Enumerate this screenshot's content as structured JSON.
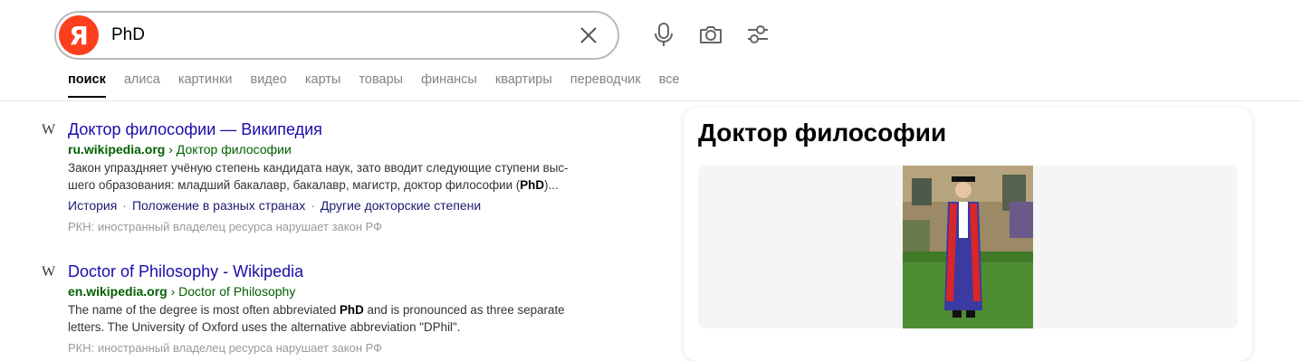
{
  "search": {
    "logo_letter": "Я",
    "query": "PhD"
  },
  "tabs": [
    "поиск",
    "алиса",
    "картинки",
    "видео",
    "карты",
    "товары",
    "финансы",
    "квартиры",
    "переводчик",
    "все"
  ],
  "results": [
    {
      "favicon": "W",
      "title": "Доктор философии — Википедия",
      "domain": "ru.wikipedia.org",
      "path": "› Доктор философии",
      "snippet_line1": "Закон упраздняет учёную степень кандидата наук, зато вводит следующие ступени выс-",
      "snippet_line2_pre": "шего образования: младший бакалавр, бакалавр, магистр, доктор философии (",
      "snippet_bold": "PhD",
      "snippet_line2_post": ")...",
      "links": [
        "История",
        "Положение в разных странах",
        "Другие докторские степени"
      ],
      "warning": "РКН: иностранный владелец ресурса нарушает закон РФ"
    },
    {
      "favicon": "W",
      "title": "Doctor of Philosophy - Wikipedia",
      "domain": "en.wikipedia.org",
      "path": "› Doctor of Philosophy",
      "snippet_line1_pre": "The name of the degree is most often abbreviated ",
      "snippet_bold": "PhD",
      "snippet_line1_post": " and is pronounced as three separate",
      "snippet_line2": "letters. The University of Oxford uses the alternative abbreviation \"DPhil\".",
      "warning": "РКН: иностранный владелец ресурса нарушает закон РФ"
    }
  ],
  "panel": {
    "title": "Доктор философии"
  },
  "colors": {
    "logo": "#fc3f1d",
    "link": "#1a0dab",
    "url": "#006000"
  }
}
